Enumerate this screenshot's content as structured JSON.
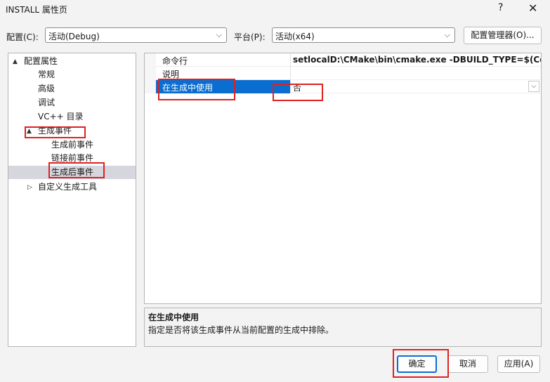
{
  "window": {
    "title": "INSTALL 属性页",
    "help": "?",
    "close": "✕"
  },
  "toolbar": {
    "config_label": "配置(C):",
    "config_value": "活动(Debug)",
    "platform_label": "平台(P):",
    "platform_value": "活动(x64)",
    "config_manager": "配置管理器(O)..."
  },
  "tree": {
    "root": "配置属性",
    "items": [
      "常规",
      "高级",
      "调试",
      "VC++ 目录"
    ],
    "build_events": "生成事件",
    "build_events_children": [
      "生成前事件",
      "链接前事件",
      "生成后事件"
    ],
    "custom_build": "自定义生成工具"
  },
  "properties": [
    {
      "name": "命令行",
      "value": "setlocalD:\\CMake\\bin\\cmake.exe -DBUILD_TYPE=$(Configuration) -P cmake_install.cmake"
    },
    {
      "name": "说明",
      "value": ""
    },
    {
      "name": "在生成中使用",
      "value": "否"
    }
  ],
  "description": {
    "title": "在生成中使用",
    "text": "指定是否将该生成事件从当前配置的生成中排除。"
  },
  "buttons": {
    "ok": "确定",
    "cancel": "取消",
    "apply": "应用(A)"
  },
  "icons": {
    "expanded": "▲",
    "collapsed": "▷",
    "dropdown": "⌵"
  },
  "colors": {
    "selection": "#0a6ed1",
    "annotation": "#e02020"
  }
}
